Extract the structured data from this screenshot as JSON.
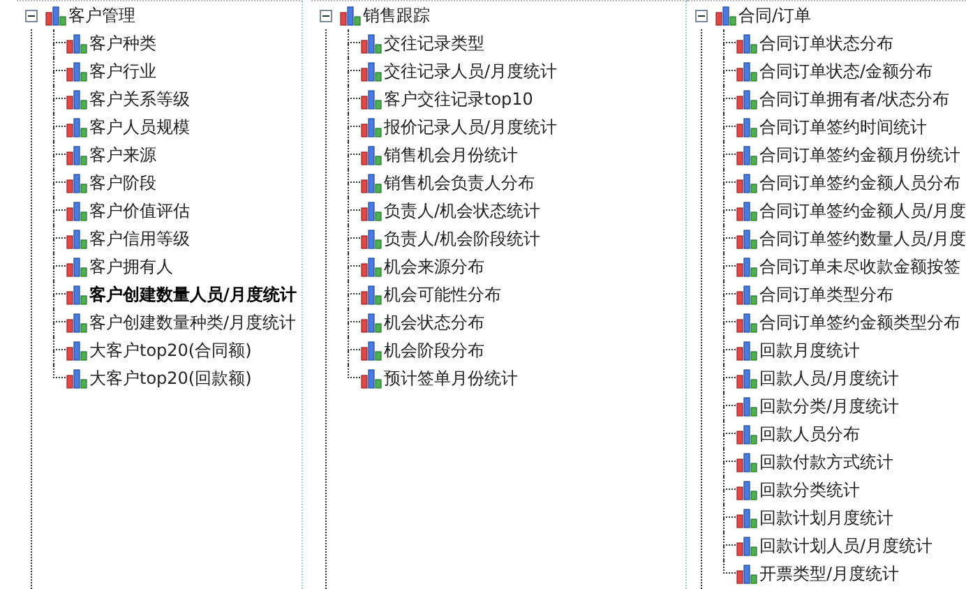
{
  "trees": [
    {
      "label": "客户管理",
      "expanded": true,
      "children": [
        {
          "label": "客户种类",
          "selected": false
        },
        {
          "label": "客户行业",
          "selected": false
        },
        {
          "label": "客户关系等级",
          "selected": false
        },
        {
          "label": "客户人员规模",
          "selected": false
        },
        {
          "label": "客户来源",
          "selected": false
        },
        {
          "label": "客户阶段",
          "selected": false
        },
        {
          "label": "客户价值评估",
          "selected": false
        },
        {
          "label": "客户信用等级",
          "selected": false
        },
        {
          "label": "客户拥有人",
          "selected": false
        },
        {
          "label": "客户创建数量人员/月度统计",
          "selected": true
        },
        {
          "label": "客户创建数量种类/月度统计",
          "selected": false
        },
        {
          "label": "大客户top20(合同额)",
          "selected": false
        },
        {
          "label": "大客户top20(回款额)",
          "selected": false
        }
      ]
    },
    {
      "label": "销售跟踪",
      "expanded": true,
      "children": [
        {
          "label": "交往记录类型",
          "selected": false
        },
        {
          "label": "交往记录人员/月度统计",
          "selected": false
        },
        {
          "label": "客户交往记录top10",
          "selected": false
        },
        {
          "label": "报价记录人员/月度统计",
          "selected": false
        },
        {
          "label": "销售机会月份统计",
          "selected": false
        },
        {
          "label": "销售机会负责人分布",
          "selected": false
        },
        {
          "label": "负责人/机会状态统计",
          "selected": false
        },
        {
          "label": "负责人/机会阶段统计",
          "selected": false
        },
        {
          "label": "机会来源分布",
          "selected": false
        },
        {
          "label": "机会可能性分布",
          "selected": false
        },
        {
          "label": "机会状态分布",
          "selected": false
        },
        {
          "label": "机会阶段分布",
          "selected": false
        },
        {
          "label": "预计签单月份统计",
          "selected": false
        }
      ]
    },
    {
      "label": "合同/订单",
      "expanded": true,
      "children": [
        {
          "label": "合同订单状态分布",
          "selected": false
        },
        {
          "label": "合同订单状态/金额分布",
          "selected": false
        },
        {
          "label": "合同订单拥有者/状态分布",
          "selected": false
        },
        {
          "label": "合同订单签约时间统计",
          "selected": false
        },
        {
          "label": "合同订单签约金额月份统计",
          "selected": false
        },
        {
          "label": "合同订单签约金额人员分布",
          "selected": false
        },
        {
          "label": "合同订单签约金额人员/月度",
          "selected": false
        },
        {
          "label": "合同订单签约数量人员/月度",
          "selected": false
        },
        {
          "label": "合同订单未尽收款金额按签",
          "selected": false
        },
        {
          "label": "合同订单类型分布",
          "selected": false
        },
        {
          "label": "合同订单签约金额类型分布",
          "selected": false
        },
        {
          "label": "回款月度统计",
          "selected": false
        },
        {
          "label": "回款人员/月度统计",
          "selected": false
        },
        {
          "label": "回款分类/月度统计",
          "selected": false
        },
        {
          "label": "回款人员分布",
          "selected": false
        },
        {
          "label": "回款付款方式统计",
          "selected": false
        },
        {
          "label": "回款分类统计",
          "selected": false
        },
        {
          "label": "回款计划月度统计",
          "selected": false
        },
        {
          "label": "回款计划人员/月度统计",
          "selected": false
        },
        {
          "label": "开票类型/月度统计",
          "selected": false
        }
      ]
    }
  ]
}
